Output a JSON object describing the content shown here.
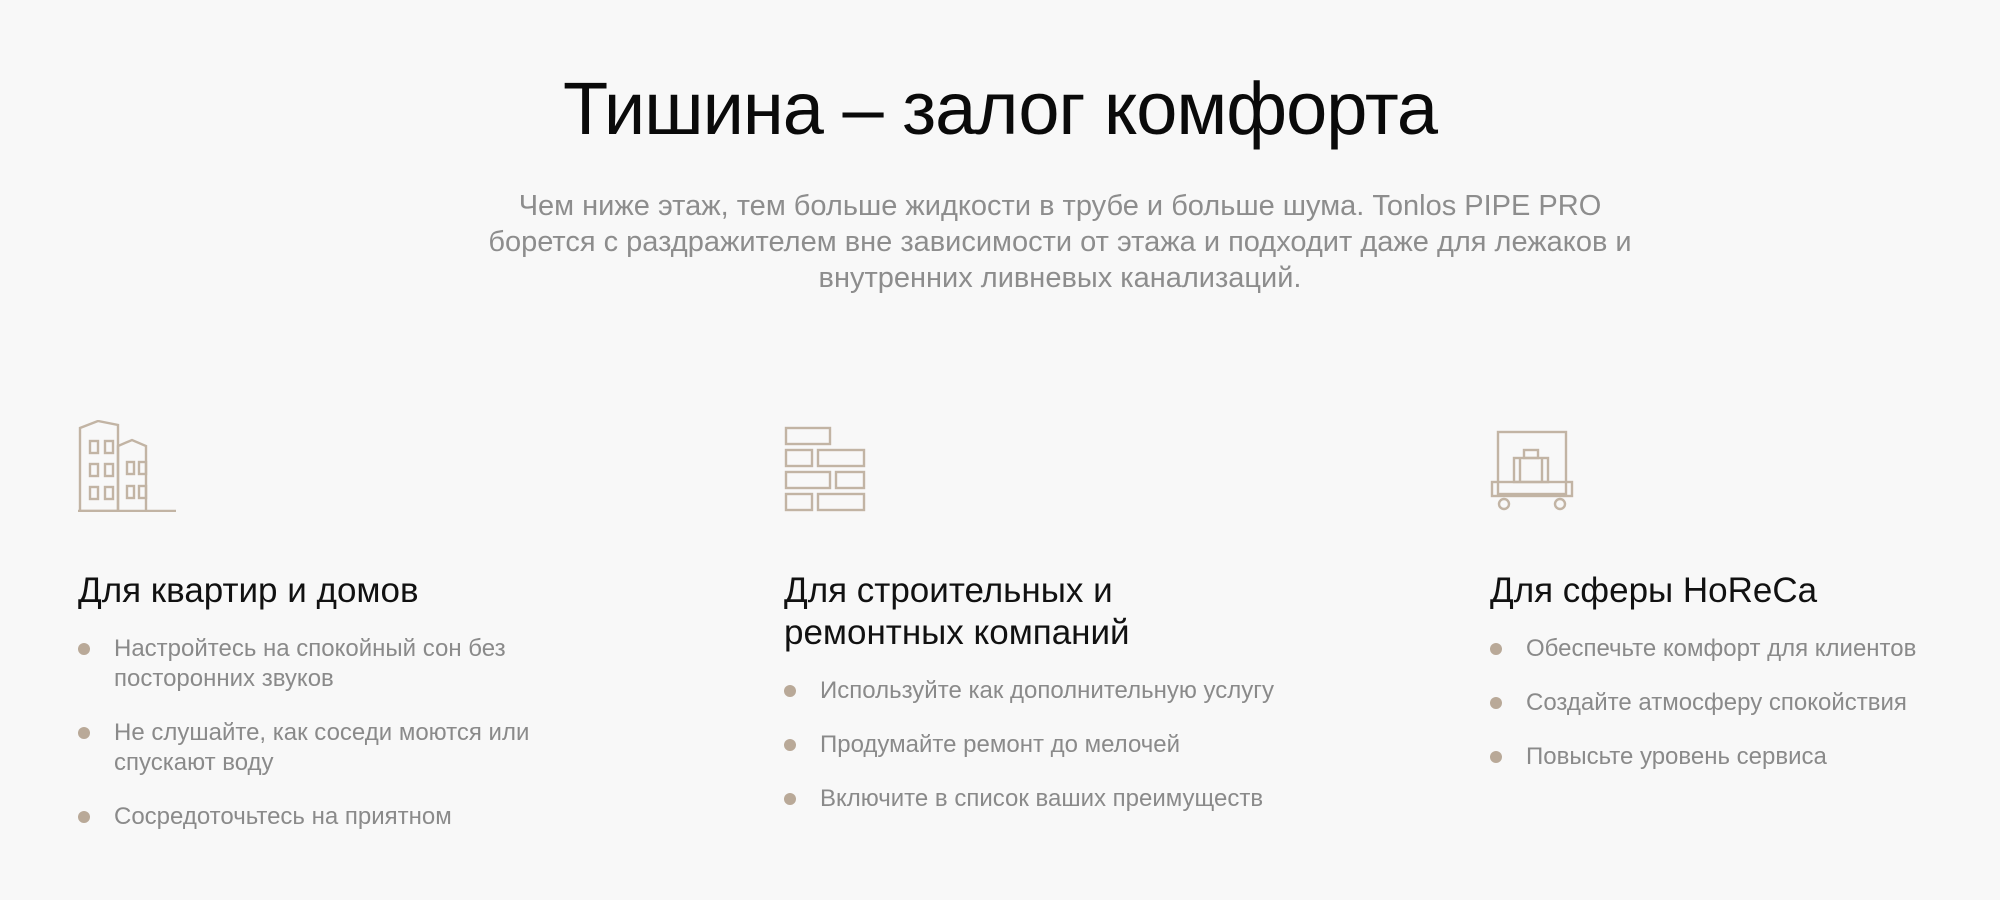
{
  "hero": {
    "title": "Тишина – залог комфорта",
    "subtitle": "Чем ниже этаж, тем больше жидкости в трубе и больше шума. Tonlos PIPE PRO борется с раздражителем вне зависимости от этажа и подходит даже для лежаков и внутренних ливневых канализаций."
  },
  "colors": {
    "background": "#f8f8f8",
    "icon_stroke": "#c2b4a4",
    "bullet": "#b9a998",
    "body_text": "#8a8a8a"
  },
  "columns": [
    {
      "icon": "buildings-icon",
      "heading": "Для квартир и домов",
      "bullets": [
        "Настройтесь на спокойный сон без посторонних звуков",
        "Не слушайте, как соседи моются или спускают воду",
        "Сосредоточьтесь на приятном"
      ]
    },
    {
      "icon": "brick-wall-icon",
      "heading": "Для строительных и ремонтных компаний",
      "bullets": [
        "Используйте как дополнительную услугу",
        "Продумайте ремонт до мелочей",
        "Включите в список ваших преимуществ"
      ]
    },
    {
      "icon": "luggage-cart-icon",
      "heading": "Для сферы HoReCa",
      "bullets": [
        "Обеспечьте комфорт для клиентов",
        "Создайте атмосферу спокойствия",
        "Повысьте уровень сервиса"
      ]
    }
  ]
}
